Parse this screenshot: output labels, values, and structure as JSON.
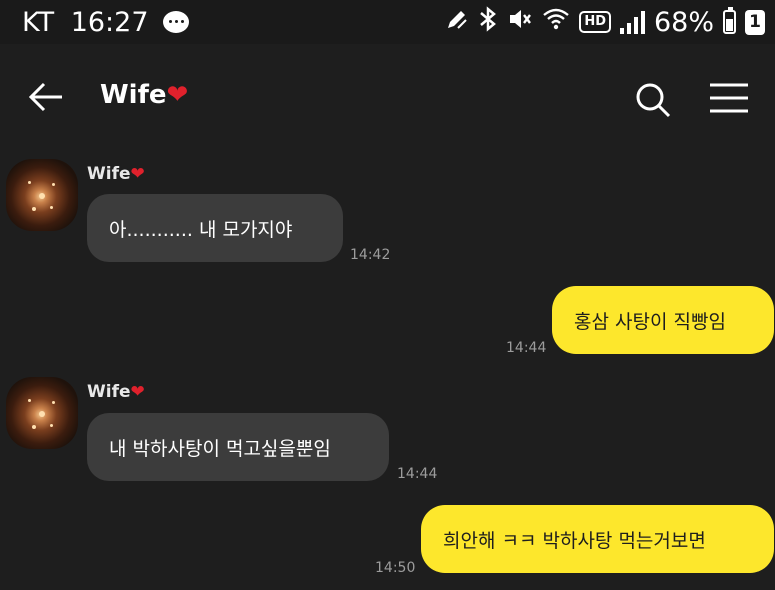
{
  "status_bar": {
    "carrier": "KT",
    "time": "16:27",
    "battery_percent": "68%",
    "sim_badge": "1",
    "hd_label": "HD"
  },
  "header": {
    "contact_name": "Wife",
    "heart": "❤"
  },
  "messages": [
    {
      "direction": "in",
      "sender": "Wife",
      "heart": "❤",
      "text": "아........... 내 모가지야",
      "time": "14:42"
    },
    {
      "direction": "out",
      "text": "홍삼 사탕이 직빵임",
      "time": "14:44"
    },
    {
      "direction": "in",
      "sender": "Wife",
      "heart": "❤",
      "text": "내 박하사탕이 먹고싶을뿐임",
      "time": "14:44"
    },
    {
      "direction": "out",
      "text": "희안해 ㅋㅋ 박하사탕 먹는거보면",
      "time": "14:50"
    }
  ],
  "colors": {
    "background": "#1e1e1e",
    "incoming_bubble": "#3c3c3c",
    "outgoing_bubble": "#fde72c",
    "heart": "#e0212c"
  },
  "icons": [
    "chat-icon",
    "pen-icon",
    "bluetooth-icon",
    "mute-icon",
    "wifi-icon",
    "signal-icon",
    "battery-icon",
    "back-arrow-icon",
    "search-icon",
    "menu-icon"
  ]
}
